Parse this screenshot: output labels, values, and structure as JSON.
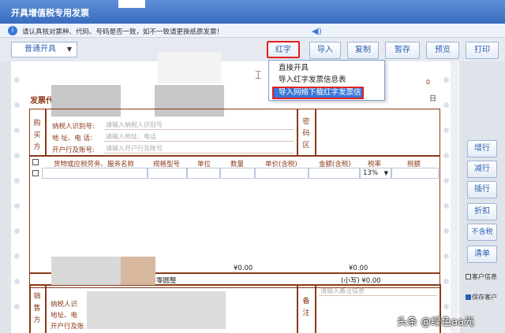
{
  "window": {
    "title": "开具增值税专用发票"
  },
  "notice": {
    "prefix": "请认真核对票种、代码、号码是否一致，如不一致请更换纸质发票！"
  },
  "toolbar": {
    "mode_select": "普通开具",
    "red_button": "红字",
    "import_button": "导入",
    "copy_button": "复制",
    "save_button": "暂存",
    "preview_button": "预览",
    "print_button": "打印"
  },
  "red_menu": {
    "items": [
      "直接开具",
      "导入红字发票信息表",
      "导入网络下载红字发票信"
    ]
  },
  "invoice": {
    "code_label": "发票代",
    "buyer_label": "购买方",
    "buyer_fields": [
      {
        "label": "纳税人识别号:",
        "placeholder": "请输入纳税人识别号"
      },
      {
        "label": "地  址、电 话:",
        "placeholder": "请输入地址、电话"
      },
      {
        "label": "开户行及账号:",
        "placeholder": "请输入开户行及账号"
      }
    ],
    "cipher_label": "密码区",
    "columns": [
      "货物或应税劳务、服务名称",
      "规格型号",
      "单位",
      "数量",
      "单价(含税)",
      "金额(含税)",
      "税率",
      "税额"
    ],
    "tax_rate": "13%",
    "total_amount": "¥0.00",
    "total_tax": "¥0.00",
    "zero_label": "零圆整",
    "small_total": "(小写) ¥0.00",
    "seller_label": "销售方",
    "seller_fields": [
      "纳税人识",
      "地址、电",
      "开户行及账"
    ],
    "remark_label": "备注",
    "remark_placeholder": "请输入备注信息",
    "number_fragment": "日",
    "count_fragment": "0"
  },
  "side_buttons": [
    "增行",
    "减行",
    "插行",
    "折扣",
    "不含税",
    "清单"
  ],
  "side_checks": [
    "客户信息",
    "保存客户"
  ],
  "watermark": "头条 @绿色aa光"
}
